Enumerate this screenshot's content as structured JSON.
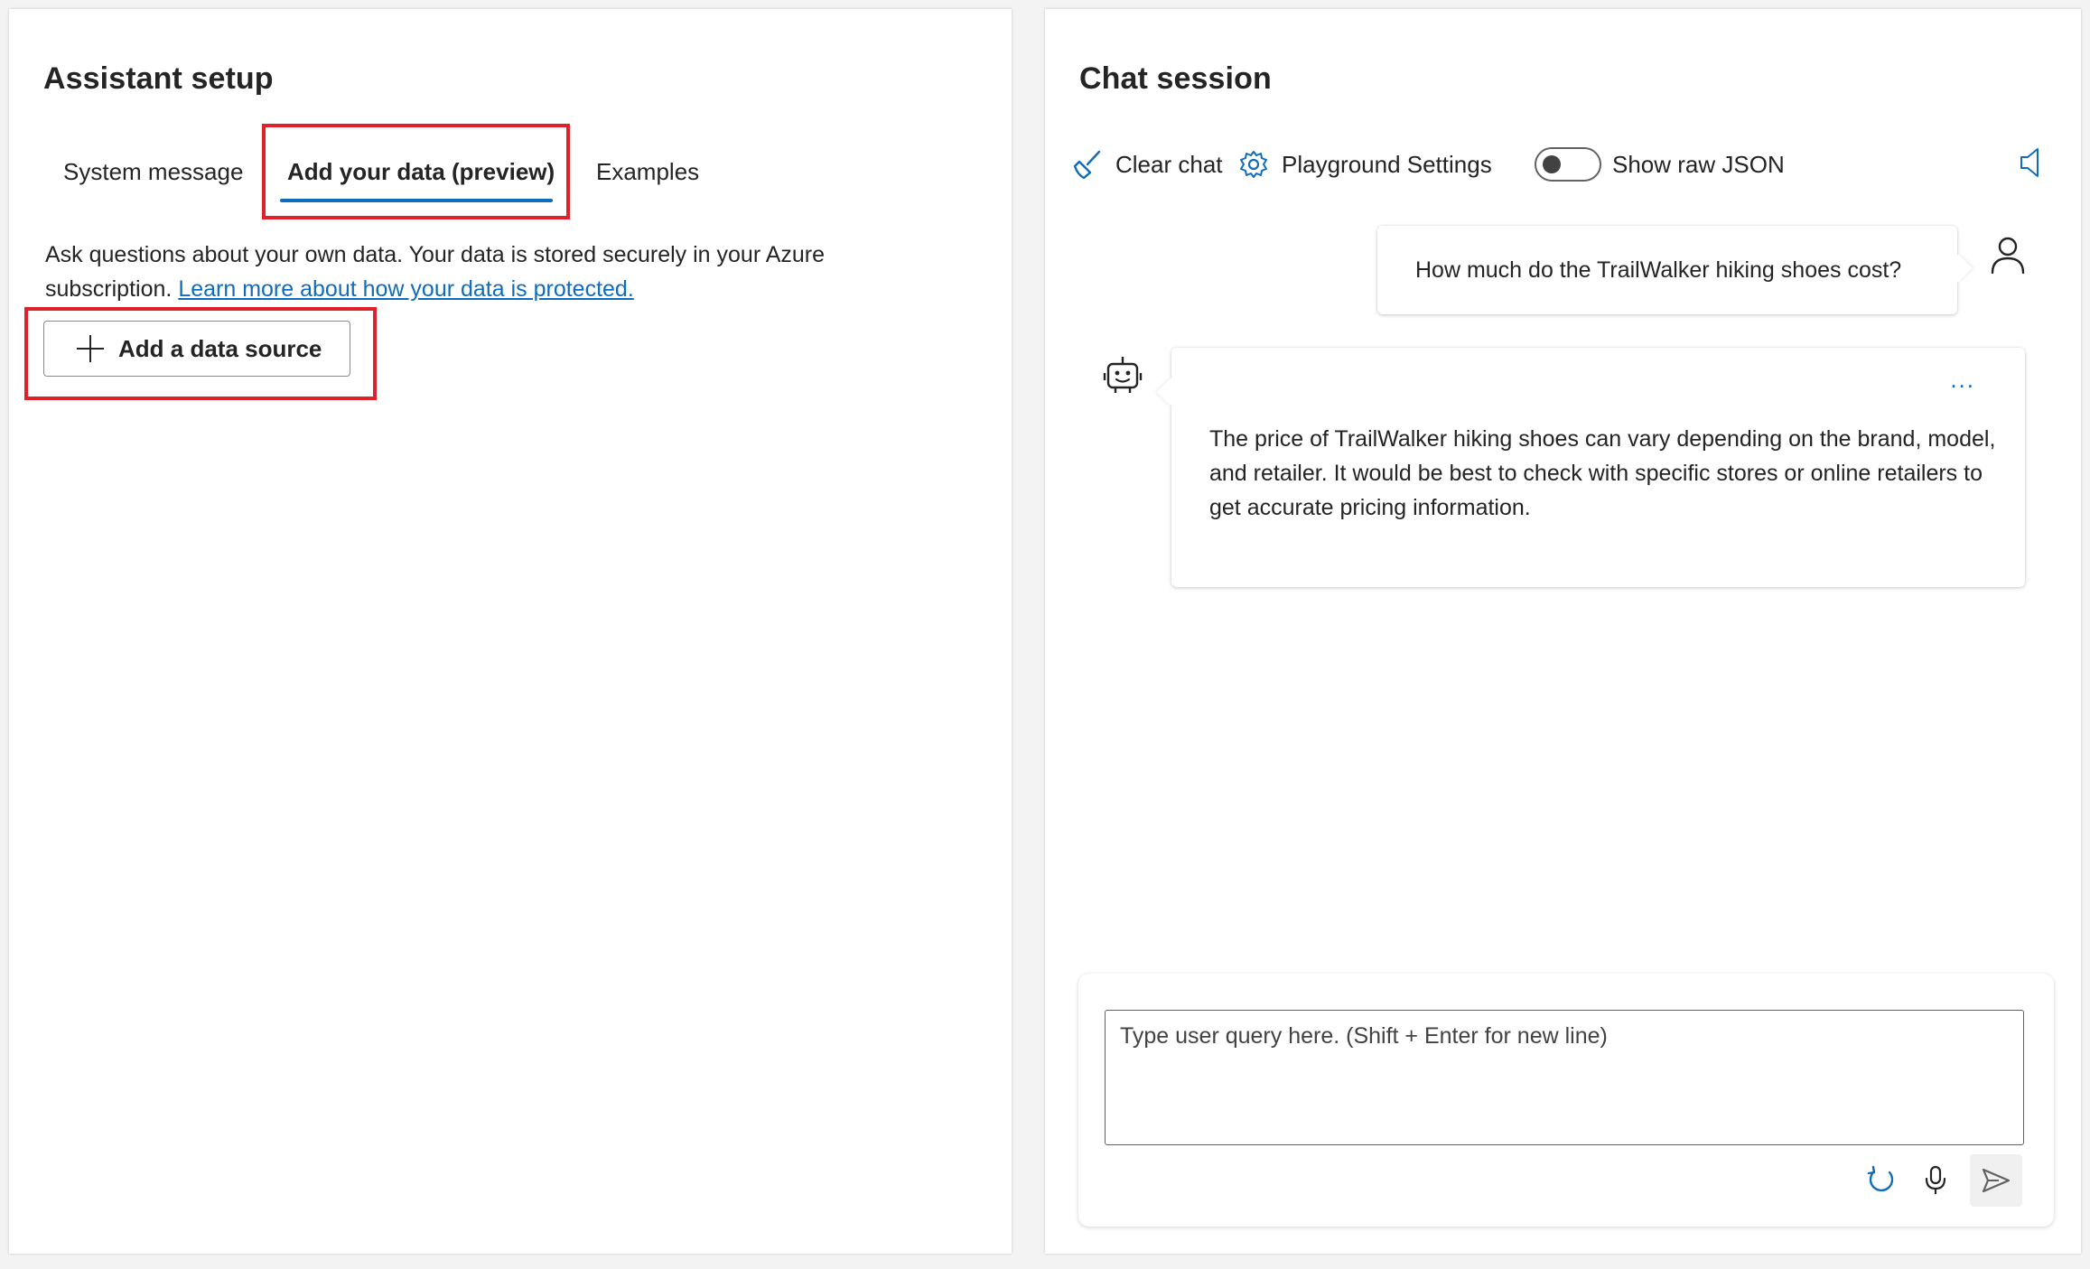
{
  "setup": {
    "title": "Assistant setup",
    "tabs": [
      {
        "label": "System message"
      },
      {
        "label": "Add your data (preview)"
      },
      {
        "label": "Examples"
      }
    ],
    "description": "Ask questions about your own data. Your data is stored securely in your Azure subscription.",
    "link_text": "Learn more about how your data is protected.",
    "add_source_label": "Add a data source"
  },
  "chat": {
    "title": "Chat session",
    "toolbar": {
      "clear_label": "Clear chat",
      "settings_label": "Playground Settings",
      "raw_json_label": "Show raw JSON"
    },
    "user_message": "How much do the TrailWalker hiking shoes cost?",
    "assistant_message": "The price of TrailWalker hiking shoes can vary depending on the brand, model, and retailer. It would be best to check with specific stores or online retailers to get accurate pricing information.",
    "more_label": "...",
    "input_placeholder": "Type user query here. (Shift + Enter for new line)"
  },
  "colors": {
    "accent": "#0f6cbd",
    "highlight": "#e0202a"
  },
  "icons": {
    "clear": "broom-icon",
    "settings": "gear-icon",
    "speaker": "speaker-icon",
    "user": "person-icon",
    "bot": "bot-icon",
    "refresh": "refresh-icon",
    "mic": "microphone-icon",
    "send": "send-icon"
  }
}
